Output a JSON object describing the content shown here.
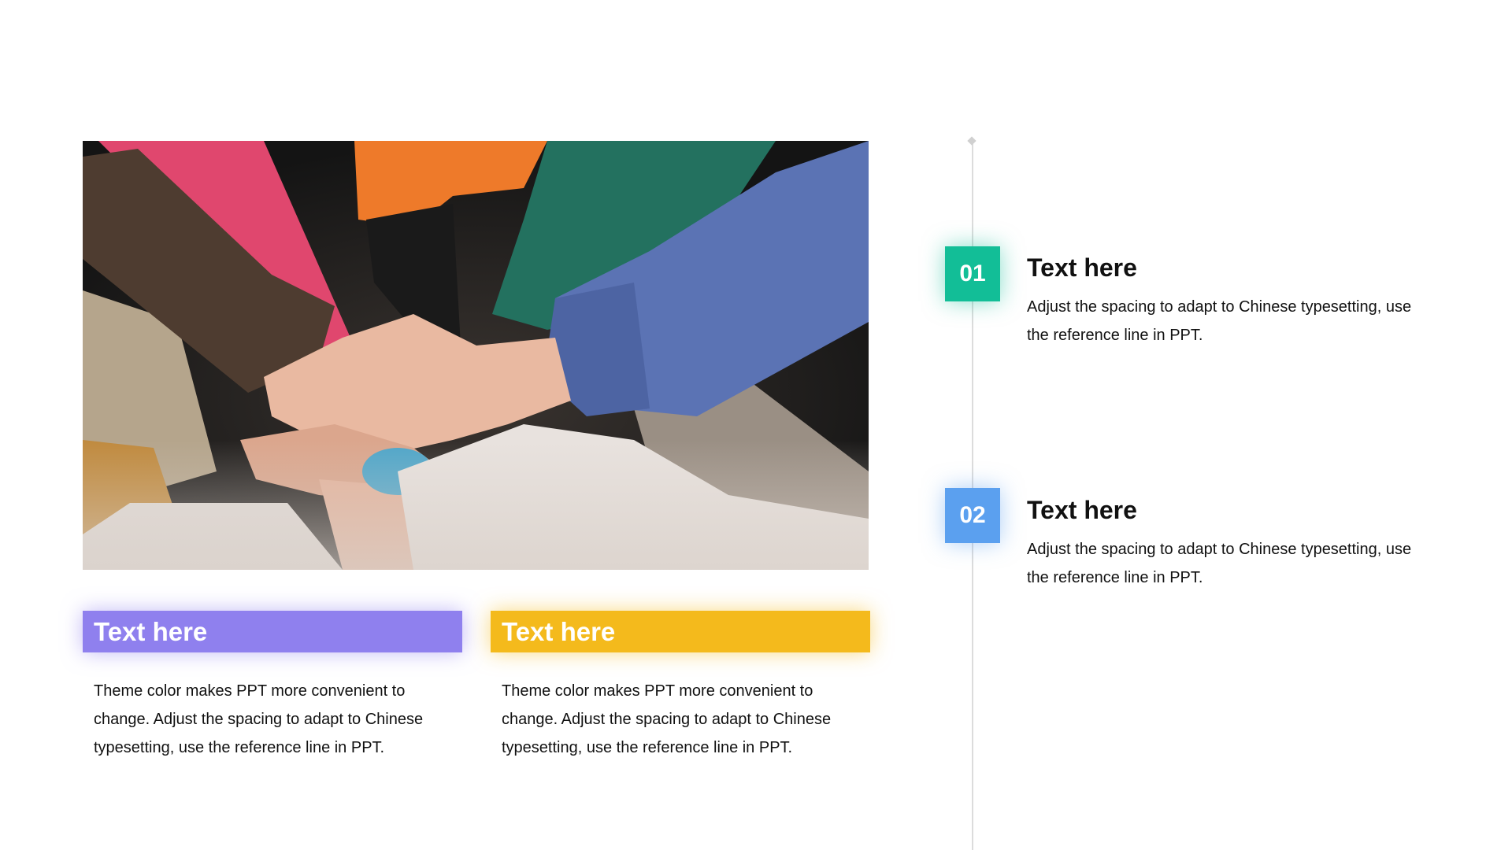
{
  "colors": {
    "purple": "#8F80EE",
    "yellow": "#F4BA1C",
    "green": "#12BE97",
    "blue": "#5BA0EF"
  },
  "photo": {
    "subject": "hands stacked together in colorful sweaters"
  },
  "cards": [
    {
      "title": "Text here",
      "body": "Theme color makes PPT more convenient to change. Adjust the spacing to adapt to Chinese typesetting, use the reference line in PPT."
    },
    {
      "title": "Text here",
      "body": "Theme color makes PPT more convenient to change. Adjust the spacing to adapt to Chinese typesetting, use the reference line in PPT."
    }
  ],
  "items": [
    {
      "number": "01",
      "title": "Text here",
      "desc": "Adjust the spacing to adapt to Chinese typesetting, use the reference line in PPT."
    },
    {
      "number": "02",
      "title": "Text here",
      "desc": "Adjust the spacing to adapt to Chinese typesetting, use the reference line in PPT."
    }
  ]
}
